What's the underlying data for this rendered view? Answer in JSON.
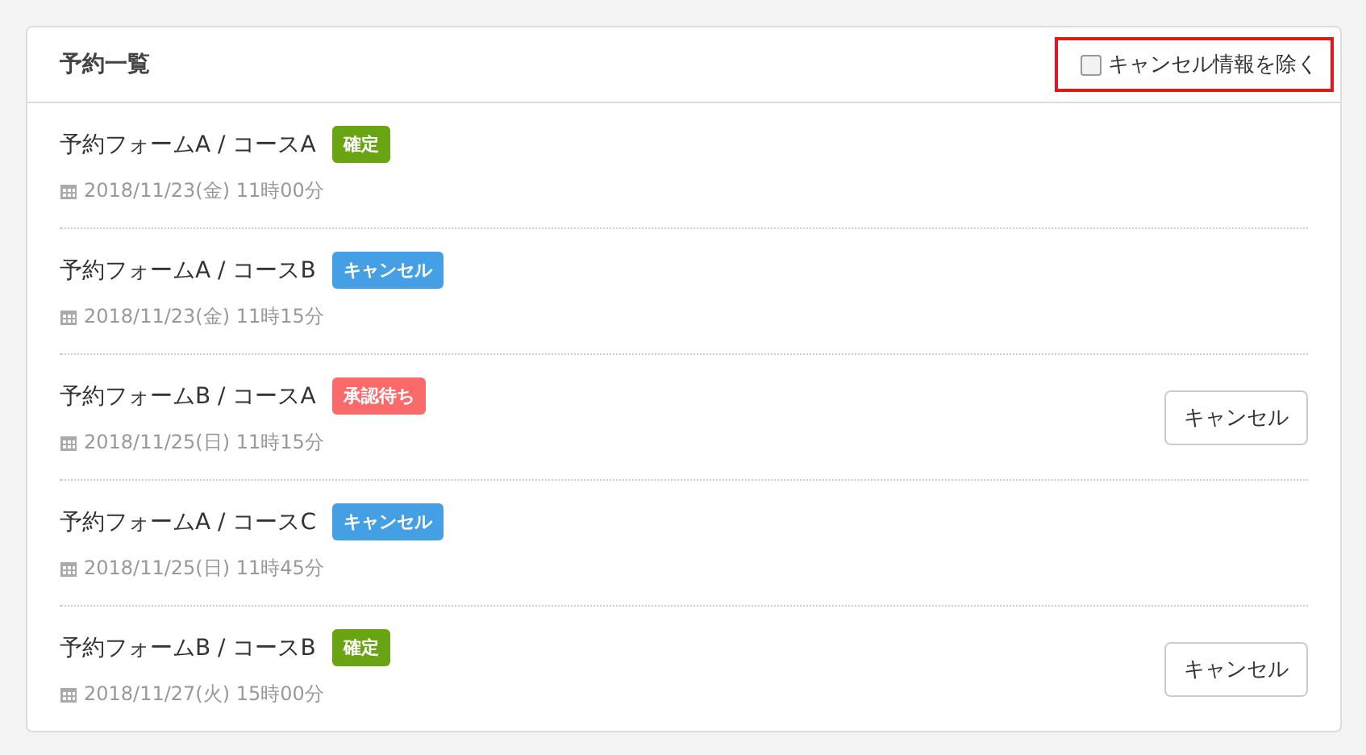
{
  "panel": {
    "title": "予約一覧",
    "filter": {
      "label": "キャンセル情報を除く",
      "checked": false,
      "highlighted": true
    }
  },
  "reservations": [
    {
      "name": "予約フォームA / コースA",
      "status": {
        "kind": "confirmed",
        "label": "確定"
      },
      "date": "2018/11/23(金) 11時00分"
    },
    {
      "name": "予約フォームA / コースB",
      "status": {
        "kind": "cancelled",
        "label": "キャンセル"
      },
      "date": "2018/11/23(金) 11時15分"
    },
    {
      "name": "予約フォームB / コースA",
      "status": {
        "kind": "pending",
        "label": "承認待ち"
      },
      "date": "2018/11/25(日) 11時15分",
      "action": "キャンセル"
    },
    {
      "name": "予約フォームA / コースC",
      "status": {
        "kind": "cancelled",
        "label": "キャンセル"
      },
      "date": "2018/11/25(日) 11時45分"
    },
    {
      "name": "予約フォームB / コースB",
      "status": {
        "kind": "confirmed",
        "label": "確定"
      },
      "date": "2018/11/27(火) 15時00分",
      "action": "キャンセル"
    }
  ]
}
